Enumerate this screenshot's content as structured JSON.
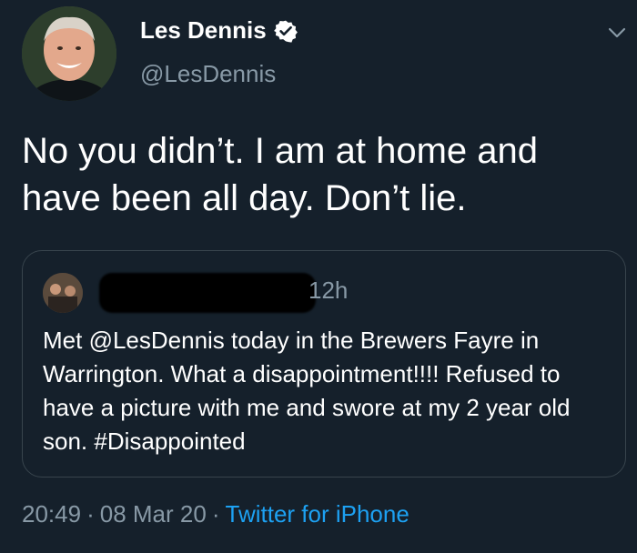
{
  "author": {
    "display_name": "Les Dennis",
    "handle": "@LesDennis",
    "verified": true
  },
  "tweet": {
    "text": "No you didn’t. I am at home and have been all day. Don’t lie."
  },
  "quoted_tweet": {
    "time_ago": "12h",
    "text": "Met @LesDennis today in the Brewers Fayre in Warrington. What a disappointment!!!! Refused to have a picture with me and swore at my 2 year old son. #Disappointed"
  },
  "footer": {
    "time": "20:49",
    "separator": "·",
    "date": "08 Mar 20",
    "source": "Twitter for iPhone"
  },
  "colors": {
    "background": "#15202b",
    "secondary_text": "#8899a6",
    "link": "#1da1f2",
    "border": "#38444d"
  },
  "icons": {
    "verified": "verified-badge-icon",
    "menu": "chevron-down-icon"
  }
}
